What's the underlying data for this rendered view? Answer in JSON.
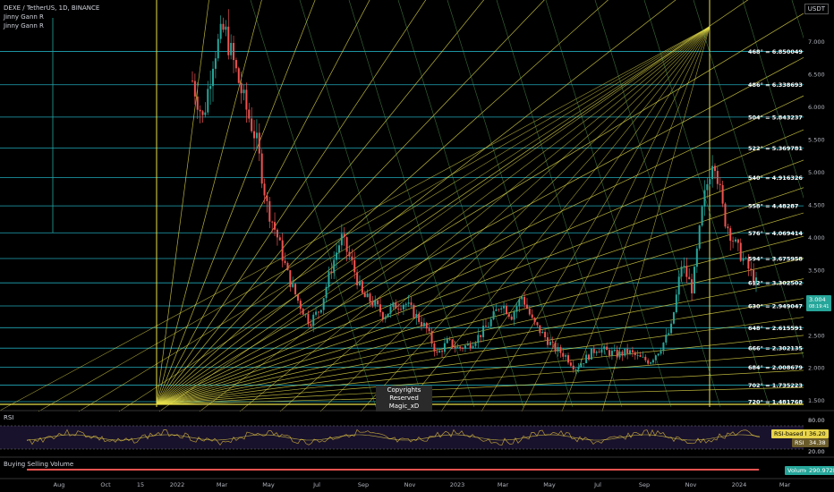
{
  "header": {
    "symbol_line": "DEXE / TetherUS, 1D, BINANCE",
    "indicator1": "Jinny Gann R",
    "indicator2": "Jinny Gann R"
  },
  "axis_unit": "USDT",
  "last_price": {
    "value": "3.004",
    "countdown": "08:19:41"
  },
  "copyright": {
    "line1": "Copyrights Reserved",
    "line2": "Magic_xD"
  },
  "rsi_panel": {
    "label": "RSI",
    "ma_label": "RSI-based MA",
    "ma_value": "36.20",
    "rsi_label": "RSI",
    "rsi_value": "34.38",
    "levels": [
      "80.00",
      "20.00"
    ]
  },
  "volume_panel": {
    "label": "Buying Selling Volume",
    "badge_label": "Volume",
    "badge_value": "290.972K"
  },
  "colors": {
    "gann_level": "#26c6da",
    "fan": "#e8e04a",
    "up": "#26a69a",
    "down": "#ef5350",
    "rsi": "#c8b04a",
    "rsi_bg": "#2a1e4a",
    "price_badge": "#26a69a"
  },
  "chart_data": {
    "type": "candlestick",
    "y_ticks": [
      "7.000",
      "6.500",
      "6.000",
      "5.500",
      "5.000",
      "4.500",
      "4.000",
      "3.500",
      "3.000",
      "2.500",
      "2.000",
      "1.500"
    ],
    "x_ticks": [
      "Aug",
      "Oct",
      "15",
      "2022",
      "Mar",
      "May",
      "Jul",
      "Sep",
      "Nov",
      "2023",
      "Mar",
      "May",
      "Jul",
      "Sep",
      "Nov",
      "2024",
      "Mar"
    ],
    "gann_levels": [
      {
        "label": "468° = 6.850049",
        "value": 6.850049
      },
      {
        "label": "486° = 6.338693",
        "value": 6.338693
      },
      {
        "label": "504° = 5.843237",
        "value": 5.843237
      },
      {
        "label": "522° = 5.369781",
        "value": 5.369781
      },
      {
        "label": "540° = 4.916326",
        "value": 4.916326
      },
      {
        "label": "558° = 4.48287",
        "value": 4.48287
      },
      {
        "label": "576° = 4.069414",
        "value": 4.069414
      },
      {
        "label": "594° = 3.675958",
        "value": 3.675958
      },
      {
        "label": "612° = 3.302502",
        "value": 3.302502
      },
      {
        "label": "630° = 2.949047",
        "value": 2.949047
      },
      {
        "label": "648° = 2.615591",
        "value": 2.615591
      },
      {
        "label": "666° = 2.302135",
        "value": 2.302135
      },
      {
        "label": "684° = 2.008679",
        "value": 2.008679
      },
      {
        "label": "702° = 1.735223",
        "value": 1.735223
      },
      {
        "label": "720° = 1.481768",
        "value": 1.481768
      }
    ],
    "price_path": [
      [
        0,
        6.4
      ],
      [
        3,
        5.8
      ],
      [
        6,
        6.8
      ],
      [
        9,
        7.2
      ],
      [
        12,
        6.6
      ],
      [
        15,
        6.0
      ],
      [
        18,
        5.5
      ],
      [
        21,
        4.5
      ],
      [
        24,
        4.0
      ],
      [
        27,
        3.4
      ],
      [
        30,
        3.0
      ],
      [
        33,
        2.7
      ],
      [
        36,
        2.9
      ],
      [
        39,
        3.5
      ],
      [
        42,
        4.0
      ],
      [
        45,
        3.6
      ],
      [
        48,
        3.1
      ],
      [
        51,
        3.0
      ],
      [
        54,
        2.8
      ],
      [
        57,
        2.95
      ],
      [
        60,
        3.0
      ],
      [
        63,
        2.8
      ],
      [
        66,
        2.6
      ],
      [
        69,
        2.2
      ],
      [
        72,
        2.4
      ],
      [
        75,
        2.3
      ],
      [
        78,
        2.35
      ],
      [
        81,
        2.5
      ],
      [
        84,
        2.7
      ],
      [
        87,
        3.0
      ],
      [
        90,
        2.8
      ],
      [
        93,
        3.1
      ],
      [
        96,
        2.7
      ],
      [
        99,
        2.5
      ],
      [
        102,
        2.3
      ],
      [
        105,
        2.2
      ],
      [
        108,
        2.0
      ],
      [
        111,
        2.15
      ],
      [
        114,
        2.3
      ],
      [
        117,
        2.25
      ],
      [
        120,
        2.2
      ],
      [
        123,
        2.25
      ],
      [
        126,
        2.15
      ],
      [
        129,
        2.1
      ],
      [
        132,
        2.3
      ],
      [
        135,
        2.6
      ],
      [
        138,
        3.6
      ],
      [
        141,
        3.2
      ],
      [
        144,
        4.5
      ],
      [
        147,
        5.3
      ],
      [
        150,
        4.3
      ],
      [
        153,
        3.9
      ],
      [
        156,
        3.6
      ],
      [
        159,
        3.3
      ]
    ]
  }
}
